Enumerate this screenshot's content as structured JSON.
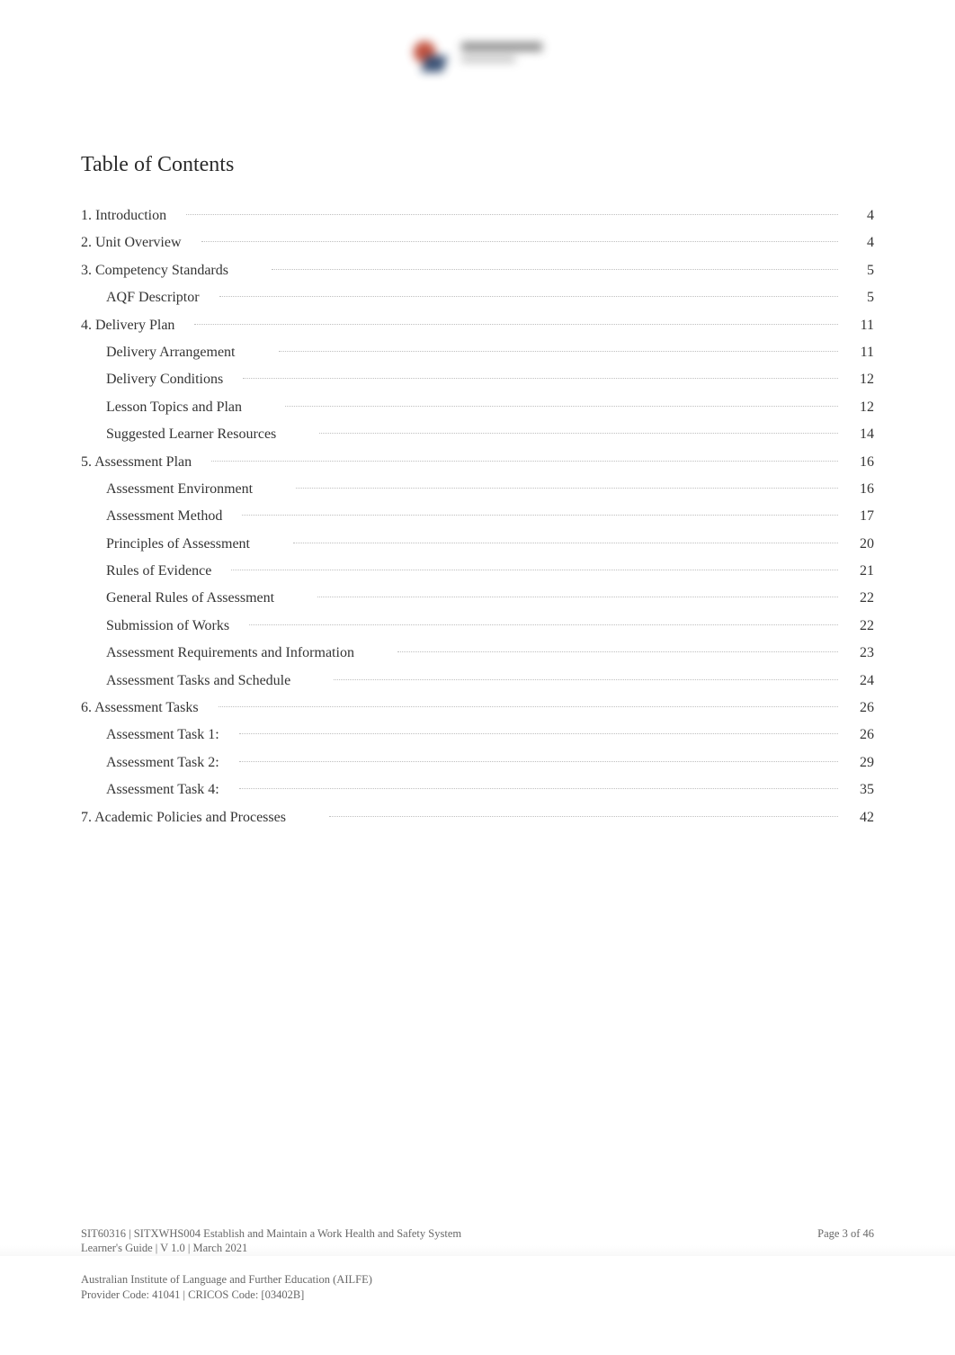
{
  "title": "Table of Contents",
  "toc": [
    {
      "level": 1,
      "label": "1. Introduction",
      "page": "4"
    },
    {
      "level": 1,
      "label": "2. Unit Overview",
      "page": "4"
    },
    {
      "level": 1,
      "label": "3. Competency Standards",
      "page": "5"
    },
    {
      "level": 2,
      "label": "AQF Descriptor",
      "page": "5"
    },
    {
      "level": 1,
      "label": "4. Delivery Plan",
      "page": "11"
    },
    {
      "level": 2,
      "label": "Delivery Arrangement",
      "page": "11"
    },
    {
      "level": 2,
      "label": "Delivery Conditions",
      "page": "12"
    },
    {
      "level": 2,
      "label": "Lesson Topics and Plan",
      "page": "12"
    },
    {
      "level": 2,
      "label": "Suggested Learner Resources",
      "page": "14"
    },
    {
      "level": 1,
      "label": "5. Assessment Plan",
      "page": "16"
    },
    {
      "level": 2,
      "label": "Assessment Environment",
      "page": "16"
    },
    {
      "level": 2,
      "label": "Assessment Method",
      "page": "17"
    },
    {
      "level": 2,
      "label": "Principles of Assessment",
      "page": "20"
    },
    {
      "level": 2,
      "label": "Rules of Evidence",
      "page": "21"
    },
    {
      "level": 2,
      "label": "General Rules of Assessment",
      "page": "22"
    },
    {
      "level": 2,
      "label": "Submission of Works",
      "page": "22"
    },
    {
      "level": 2,
      "label": "Assessment Requirements and Information",
      "page": "23"
    },
    {
      "level": 2,
      "label": "Assessment Tasks and Schedule",
      "page": "24"
    },
    {
      "level": 1,
      "label": "6. Assessment Tasks",
      "page": "26"
    },
    {
      "level": 2,
      "label": "Assessment Task 1:",
      "page": "26"
    },
    {
      "level": 2,
      "label": "Assessment Task 2:",
      "page": "29"
    },
    {
      "level": 2,
      "label": "Assessment Task 4:",
      "page": "35"
    },
    {
      "level": 1,
      "label": "7. Academic Policies and Processes",
      "page": "42"
    }
  ],
  "footer": {
    "doc_ref_line1": "SIT60316 | SITXWHS004 Establish and Maintain a Work Health and Safety System",
    "doc_ref_line2": "Learner's Guide | V 1.0 | March 2021",
    "org_line1": "Australian Institute of Language and Further Education (AILFE)",
    "org_line2": "Provider Code: 41041 | CRICOS Code: [03402B]",
    "page_label": "Page  3  of 46"
  }
}
